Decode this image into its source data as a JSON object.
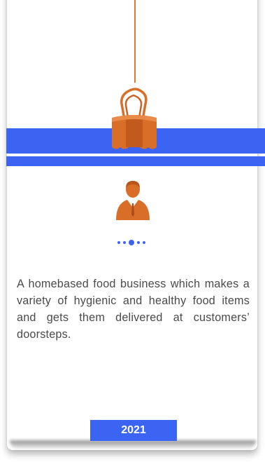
{
  "card": {
    "description": "A homebased food business which makes a variety of hygienic and healthy food items and gets them delivered at customers’ doorsteps.",
    "year": "2021"
  },
  "icons": {
    "clip": "binder-clip-icon",
    "avatar": "businessman-icon"
  },
  "pagination": {
    "total": 5,
    "active_index": 2
  },
  "colors": {
    "accent": "#3c64f2",
    "clip": "#e07a30",
    "text": "#4a4a4a"
  }
}
